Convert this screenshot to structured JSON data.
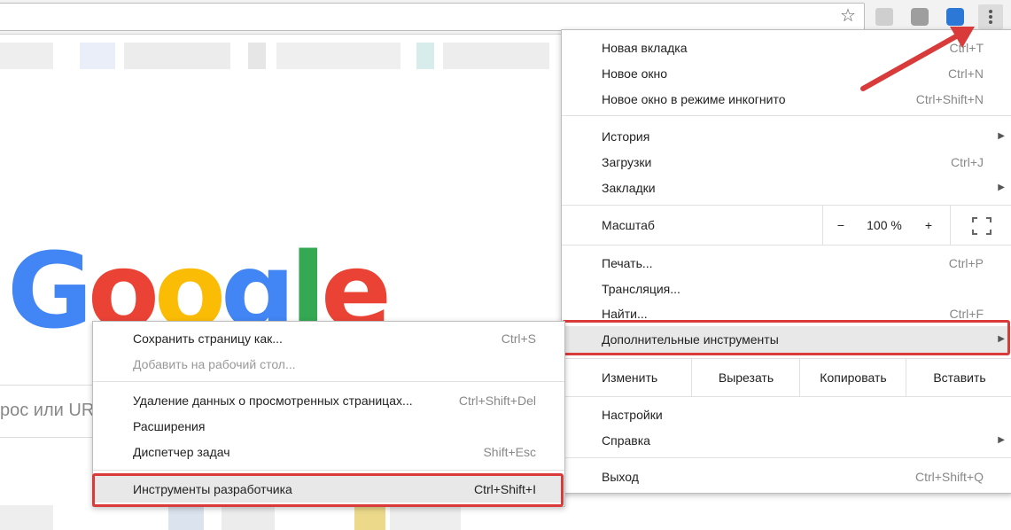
{
  "main_menu": {
    "items_group1": [
      {
        "label": "Новая вкладка",
        "shortcut": "Ctrl+T"
      },
      {
        "label": "Новое окно",
        "shortcut": "Ctrl+N"
      },
      {
        "label": "Новое окно в режиме инкогнито",
        "shortcut": "Ctrl+Shift+N"
      }
    ],
    "items_group2": [
      {
        "label": "История",
        "shortcut": ""
      },
      {
        "label": "Загрузки",
        "shortcut": "Ctrl+J"
      },
      {
        "label": "Закладки",
        "shortcut": ""
      }
    ],
    "zoom": {
      "label": "Масштаб",
      "minus": "−",
      "value": "100 %",
      "plus": "+"
    },
    "items_group3": [
      {
        "label": "Печать...",
        "shortcut": "Ctrl+P"
      },
      {
        "label": "Трансляция...",
        "shortcut": ""
      },
      {
        "label": "Найти...",
        "shortcut": "Ctrl+F"
      },
      {
        "label": "Дополнительные инструменты",
        "shortcut": ""
      }
    ],
    "edit": {
      "label": "Изменить",
      "cut": "Вырезать",
      "copy": "Копировать",
      "paste": "Вставить"
    },
    "items_group4": [
      {
        "label": "Настройки",
        "shortcut": ""
      },
      {
        "label": "Справка",
        "shortcut": ""
      }
    ],
    "exit": {
      "label": "Выход",
      "shortcut": "Ctrl+Shift+Q"
    }
  },
  "sub_menu": {
    "items_group1": [
      {
        "label": "Сохранить страницу как...",
        "shortcut": "Ctrl+S"
      },
      {
        "label": "Добавить на рабочий стол...",
        "shortcut": ""
      }
    ],
    "items_group2": [
      {
        "label": "Удаление данных о просмотренных страницах...",
        "shortcut": "Ctrl+Shift+Del"
      },
      {
        "label": "Расширения",
        "shortcut": ""
      },
      {
        "label": "Диспетчер задач",
        "shortcut": "Shift+Esc"
      }
    ],
    "dev_tools": {
      "label": "Инструменты разработчика",
      "shortcut": "Ctrl+Shift+I"
    }
  },
  "page": {
    "logo": {
      "g1": "G",
      "o1": "o",
      "o2": "o",
      "g2": "g",
      "l": "l",
      "e": "e"
    },
    "search_partial": "рос или UR"
  },
  "toolbar": {
    "star": "☆"
  },
  "colors": {
    "highlight_border": "#d93a3a",
    "google_blue": "#4285f4",
    "google_red": "#ea4335",
    "google_yellow": "#fbbc05",
    "google_green": "#34a853"
  }
}
